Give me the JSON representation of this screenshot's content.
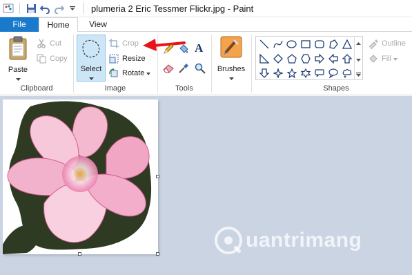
{
  "window": {
    "title": "plumeria 2 Eric Tessmer Flickr.jpg - Paint"
  },
  "tabs": [
    {
      "label": "File"
    },
    {
      "label": "Home"
    },
    {
      "label": "View"
    }
  ],
  "ribbon": {
    "clipboard": {
      "paste_label": "Paste",
      "cut_label": "Cut",
      "copy_label": "Copy",
      "group_label": "Clipboard"
    },
    "image": {
      "select_label": "Select",
      "crop_label": "Crop",
      "resize_label": "Resize",
      "rotate_label": "Rotate",
      "group_label": "Image"
    },
    "tools": {
      "group_label": "Tools",
      "text_tool_glyph": "A"
    },
    "brushes": {
      "label": "Brushes"
    },
    "shapes": {
      "outline_label": "Outline",
      "fill_label": "Fill",
      "group_label": "Shapes"
    }
  },
  "watermark": {
    "text": "uantrimang"
  },
  "colors": {
    "file_tab": "#1979ca",
    "select_highlight": "#cde6f7",
    "workspace": "#cad4e3",
    "annotation_arrow": "#e8141a"
  }
}
